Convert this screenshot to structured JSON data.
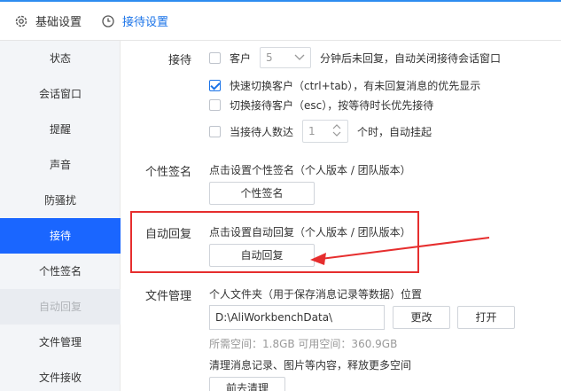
{
  "tabs": [
    {
      "label": "基础设置",
      "icon": "gear-icon"
    },
    {
      "label": "接待设置",
      "icon": "clock-icon"
    }
  ],
  "sidebar": {
    "items": [
      {
        "label": "状态"
      },
      {
        "label": "会话窗口"
      },
      {
        "label": "提醒"
      },
      {
        "label": "声音"
      },
      {
        "label": "防骚扰"
      },
      {
        "label": "接待",
        "active": true
      },
      {
        "label": "个性签名"
      },
      {
        "label": "自动回复",
        "dim": true
      },
      {
        "label": "文件管理"
      },
      {
        "label": "文件接收"
      }
    ]
  },
  "reception": {
    "label": "接待",
    "auto_close": {
      "prefix": "客户",
      "minutes": "5",
      "suffix": "分钟后未回复，自动关闭接待会话窗口",
      "checked": false
    },
    "quick_switch": {
      "text": "快速切换客户（ctrl+tab），有未回复消息的优先显示",
      "checked": true
    },
    "switch_customer": {
      "text": "切换接待客户（esc），按等待时长优先接待",
      "checked": false
    },
    "max_count": {
      "prefix": "当接待人数达",
      "value": "1",
      "suffix": "个时，自动挂起",
      "checked": false
    }
  },
  "signature": {
    "label": "个性签名",
    "hint": "点击设置个性签名（个人版本 / 团队版本）",
    "button": "个性签名"
  },
  "auto_reply": {
    "label": "自动回复",
    "hint": "点击设置自动回复（个人版本 / 团队版本）",
    "button": "自动回复"
  },
  "file_manage": {
    "label": "文件管理",
    "desc": "个人文件夹（用于保存消息记录等数据）位置",
    "path": "D:\\AliWorkbenchData\\",
    "change_button": "更改",
    "open_button": "打开",
    "space": "所需空间：1.8GB   可用空间：360.9GB",
    "clean_desc": "清理消息记录、图片等内容，释放更多空间",
    "clean_button": "前去清理"
  },
  "colors": {
    "accent": "#1a66ff",
    "highlight": "#e62e2e"
  }
}
